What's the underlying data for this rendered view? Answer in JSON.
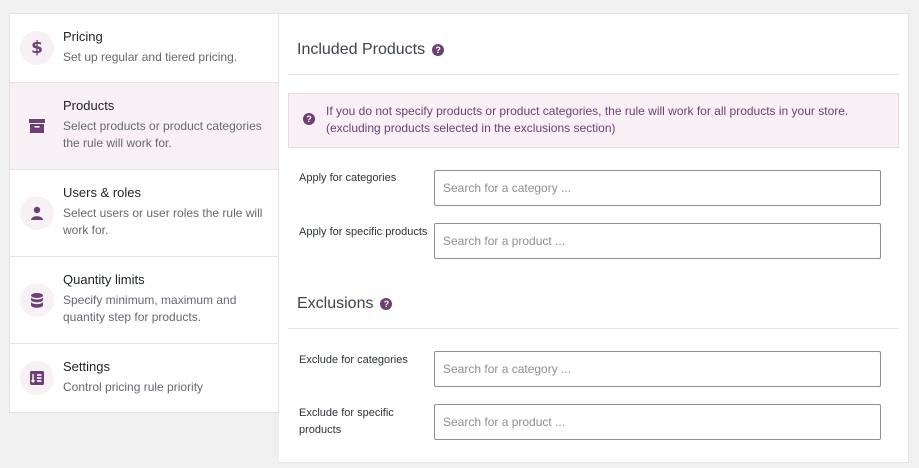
{
  "sidebar": {
    "items": [
      {
        "title": "Pricing",
        "desc": "Set up regular and tiered pricing.",
        "icon": "dollar-icon"
      },
      {
        "title": "Products",
        "desc": "Select products or product categories the rule will work for.",
        "icon": "archive-icon",
        "active": true
      },
      {
        "title": "Users & roles",
        "desc": "Select users or user roles the rule will work for.",
        "icon": "user-icon"
      },
      {
        "title": "Quantity limits",
        "desc": "Specify minimum, maximum and quantity step for products.",
        "icon": "database-icon"
      },
      {
        "title": "Settings",
        "desc": "Control pricing rule priority",
        "icon": "settings-icon"
      }
    ],
    "pricing_symbol": "$"
  },
  "included": {
    "title": "Included Products",
    "help": "?",
    "notice": "If you do not specify products or product categories, the rule will work for all products in your store. (excluding products selected in the exclusions section)",
    "categories_label": "Apply for categories",
    "categories_placeholder": "Search for a category ...",
    "products_label": "Apply for specific products",
    "products_placeholder": "Search for a product ..."
  },
  "exclusions": {
    "title": "Exclusions",
    "help": "?",
    "categories_label": "Exclude for categories",
    "categories_placeholder": "Search for a category ...",
    "products_label": "Exclude for specific products",
    "products_placeholder": "Search for a product ..."
  },
  "colors": {
    "accent": "#6d3f73",
    "active_bg": "#f7f1f6",
    "notice_bg": "#f9f0f6"
  }
}
